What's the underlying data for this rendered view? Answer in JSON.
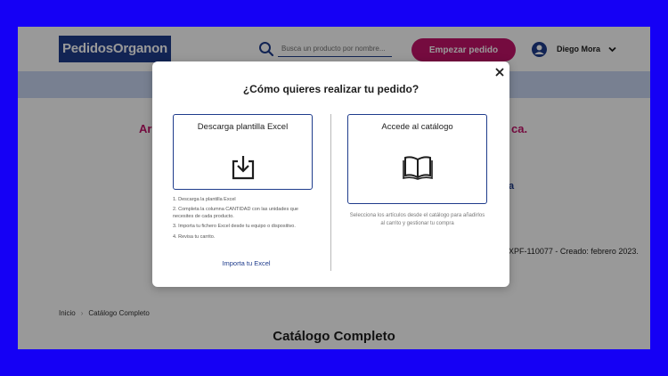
{
  "header": {
    "logo_text": "PedidosOrganon",
    "search_placeholder": "Busca un producto por nombre...",
    "start_order_label": "Empezar pedido",
    "user_name": "Diego Mora"
  },
  "background": {
    "red_heading_left": "Ar",
    "red_heading_right": "ca.",
    "blue_text_right": "a",
    "meta_text": "-XPF-110077 - Creado: febrero 2023."
  },
  "breadcrumb": {
    "home": "Inicio",
    "separator": "›",
    "current": "Catálogo Completo"
  },
  "page_title": "Catálogo Completo",
  "modal": {
    "title": "¿Cómo quieres realizar tu pedido?",
    "excel_option": {
      "label": "Descarga plantilla Excel",
      "icon": "download-icon",
      "steps": [
        "1. Descarga la plantilla Excel",
        "2. Completa la columna CANTIDAD con las unidades que necesites de cada producto.",
        "3. Importa tu fichero Excel desde tu equipo o dispositivo.",
        "4. Revisa tu carrito."
      ],
      "import_link": "Importa tu Excel"
    },
    "catalog_option": {
      "label": "Accede al catálogo",
      "icon": "book-icon",
      "description": "Selecciona los artículos desde el catálogo para añadirlos al carrito y gestionar tu compra"
    }
  },
  "colors": {
    "frame": "#1500f5",
    "brand_blue": "#1f3c8c",
    "accent_pink": "#c3136a",
    "nav_band": "#c8d6f2"
  }
}
